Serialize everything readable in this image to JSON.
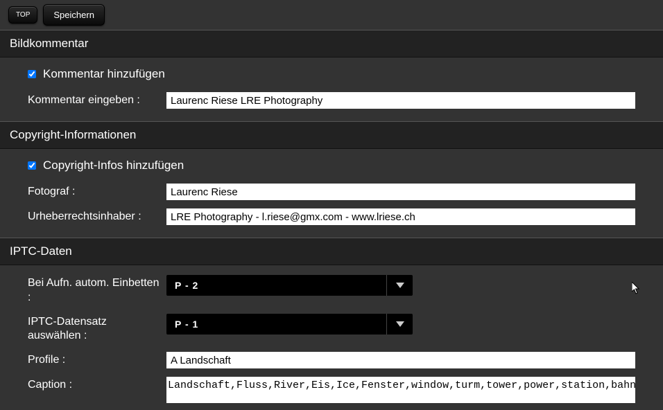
{
  "toolbar": {
    "top_label": "TOP",
    "save_label": "Speichern"
  },
  "sections": {
    "comment": {
      "title": "Bildkommentar",
      "add_checkbox_label": "Kommentar hinzufügen",
      "add_checked": true,
      "input_label": "Kommentar eingeben :",
      "input_value": "Laurenc Riese LRE Photography"
    },
    "copyright": {
      "title": "Copyright-Informationen",
      "add_checkbox_label": "Copyright-Infos hinzufügen",
      "add_checked": true,
      "photographer_label": "Fotograf :",
      "photographer_value": "Laurenc Riese",
      "owner_label": "Urheberrechtsinhaber :",
      "owner_value": "LRE Photography - l.riese@gmx.com - www.lriese.ch"
    },
    "iptc": {
      "title": "IPTC-Daten",
      "embed_label": "Bei Aufn. autom. Einbetten :",
      "embed_value": "P - 2",
      "record_label": "IPTC-Datensatz auswählen :",
      "record_value": "P - 1",
      "profile_label": "Profile :",
      "profile_value": "A Landschaft",
      "caption_label": "Caption :",
      "caption_value": "Landschaft,Fluss,River,Eis,Ice,Fenster,window,turm,tower,power,station,bahnhof,national,geography,plant,pflanze,grün,green,blau,blue,rot,red,gelb,yellow,"
    }
  }
}
